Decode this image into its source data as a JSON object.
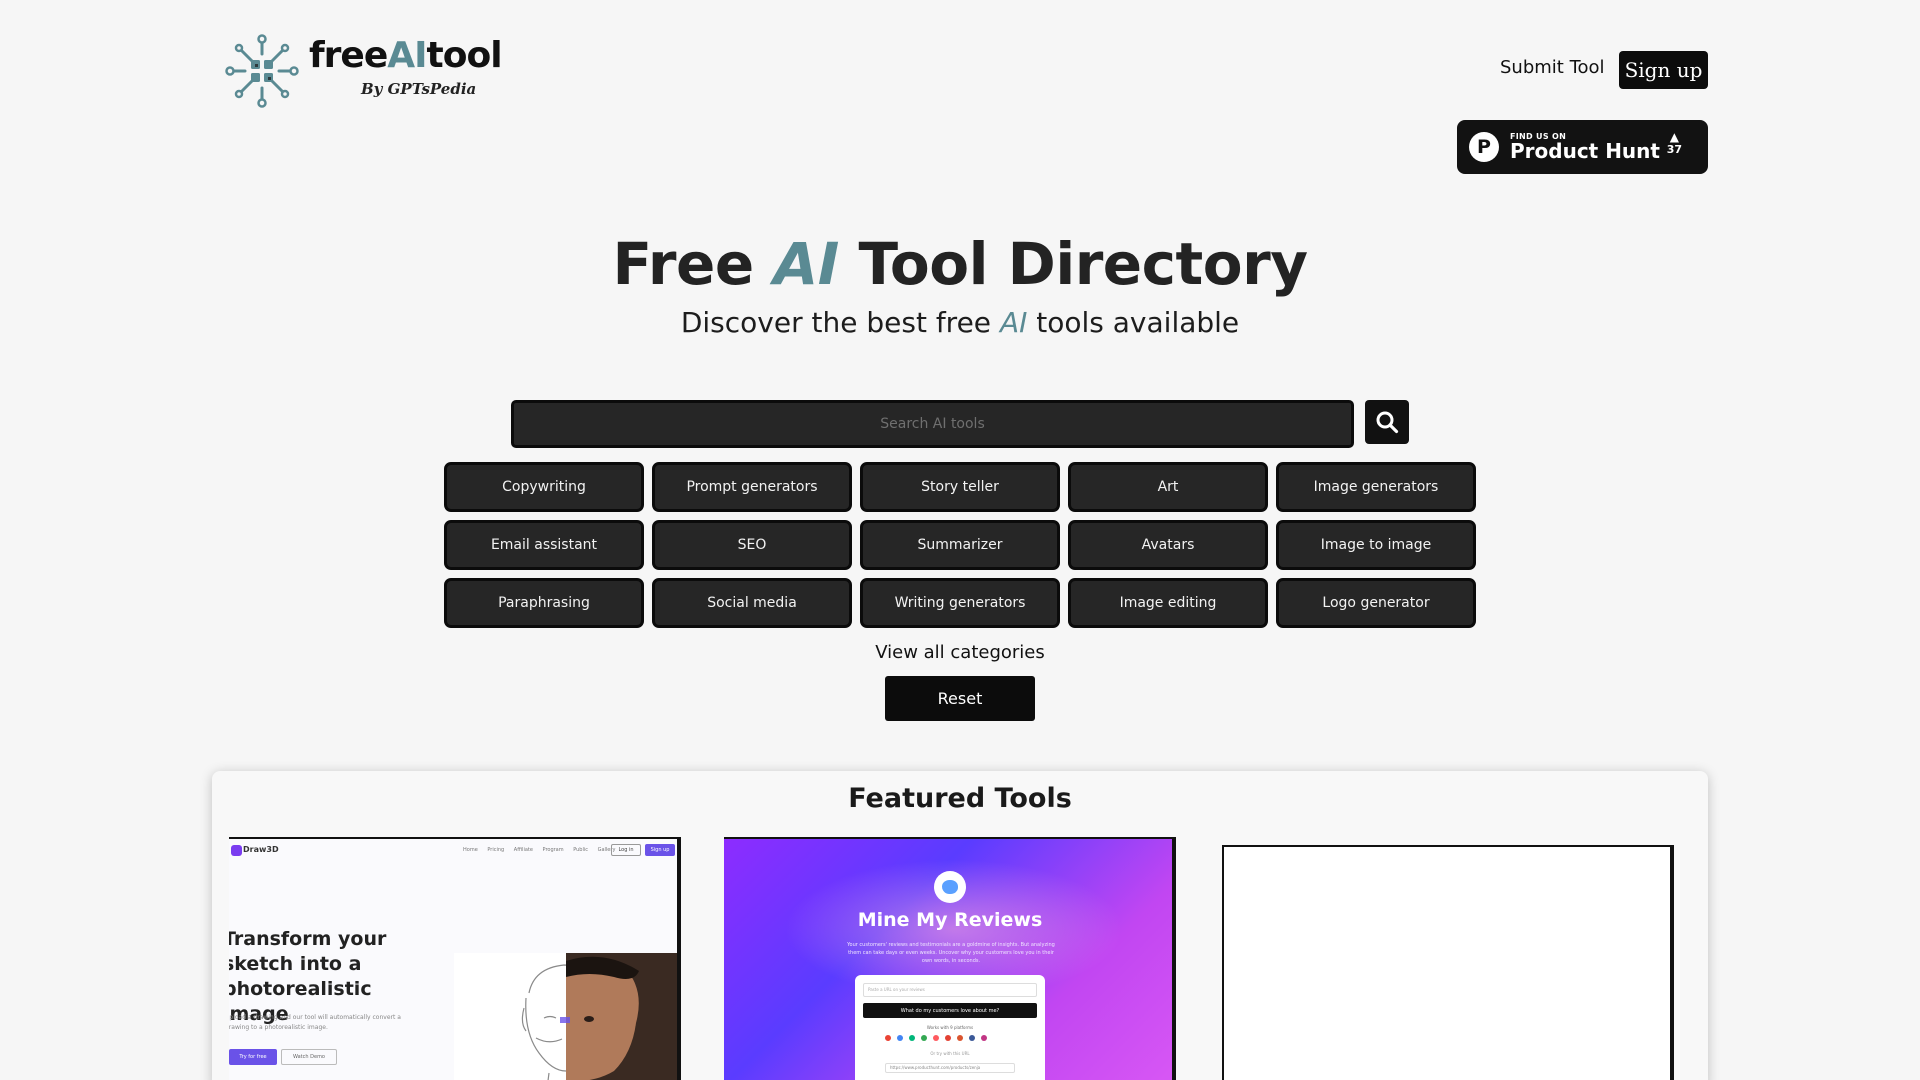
{
  "header": {
    "logo_name_prefix": "free",
    "logo_name_ai": "AI",
    "logo_name_suffix": "tool",
    "logo_by": "By GPTsPedia",
    "submit_label": "Submit Tool",
    "signup_label": "Sign up"
  },
  "product_hunt": {
    "small": "FIND US ON",
    "big": "Product Hunt",
    "votes": "37"
  },
  "hero": {
    "title_prefix": "Free",
    "title_ai": "AI",
    "title_suffix": "Tool Directory",
    "sub_prefix": "Discover the best free",
    "sub_ai": "AI",
    "sub_suffix": "tools available"
  },
  "search": {
    "placeholder": "Search AI tools"
  },
  "categories": [
    "Copywriting",
    "Prompt generators",
    "Story teller",
    "Art",
    "Image generators",
    "Email assistant",
    "SEO",
    "Summarizer",
    "Avatars",
    "Image to image",
    "Paraphrasing",
    "Social media",
    "Writing generators",
    "Image editing",
    "Logo generator"
  ],
  "view_all_label": "View all categories",
  "reset_label": "Reset",
  "featured": {
    "title": "Featured Tools",
    "card1": {
      "brand": "Draw3D",
      "nav_links": "Home Pricing Affiliate Program Public Gallery",
      "login": "Log in",
      "signup": "Sign up",
      "heading": "Transform your sketch into a photorealistic image",
      "description": "Upload a drawing and our tool will automatically convert a drawing to a photorealistic image.",
      "try_label": "Try for free",
      "demo_label": "Watch Demo"
    },
    "card2": {
      "title": "Mine My Reviews",
      "description": "Your customers' reviews and testimonials are a goldmine of insights. But analyzing them can take days or even weeks. Uncover why your customers love you in their own words, in seconds.",
      "input_placeholder": "Paste a URL on your reviews",
      "cta": "What do my customers love about me?",
      "works_with": "Works with 9 platforms",
      "note": "Or try with this URL",
      "url": "https://www.producthunt.com/products/zenja"
    }
  },
  "colors": {
    "accent": "#5a8a93",
    "button_dark": "#262626",
    "background": "#f6f6f6"
  },
  "icons": {
    "search": "magnifier-icon",
    "logo": "circuit-logo-icon",
    "product_hunt": "product-hunt-icon"
  }
}
